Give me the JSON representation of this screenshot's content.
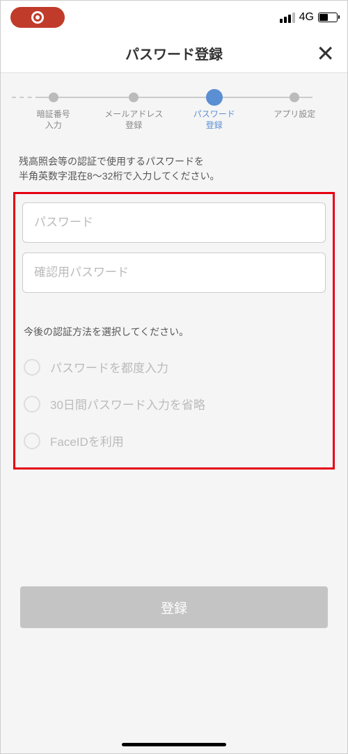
{
  "statusBar": {
    "network": "4G"
  },
  "header": {
    "title": "パスワード登録"
  },
  "stepper": {
    "steps": [
      {
        "label": "暗証番号\n入力",
        "active": false
      },
      {
        "label": "メールアドレス\n登録",
        "active": false
      },
      {
        "label": "パスワード\n登録",
        "active": true
      },
      {
        "label": "アプリ設定",
        "active": false
      }
    ]
  },
  "instructions": "残高照会等の認証で使用するパスワードを\n半角英数字混在8～32桁で入力してください。",
  "inputs": {
    "password_placeholder": "パスワード",
    "confirm_placeholder": "確認用パスワード"
  },
  "authSection": {
    "heading": "今後の認証方法を選択してください。",
    "options": [
      "パスワードを都度入力",
      "30日間パスワード入力を省略",
      "FaceIDを利用"
    ]
  },
  "submit": {
    "label": "登録"
  }
}
